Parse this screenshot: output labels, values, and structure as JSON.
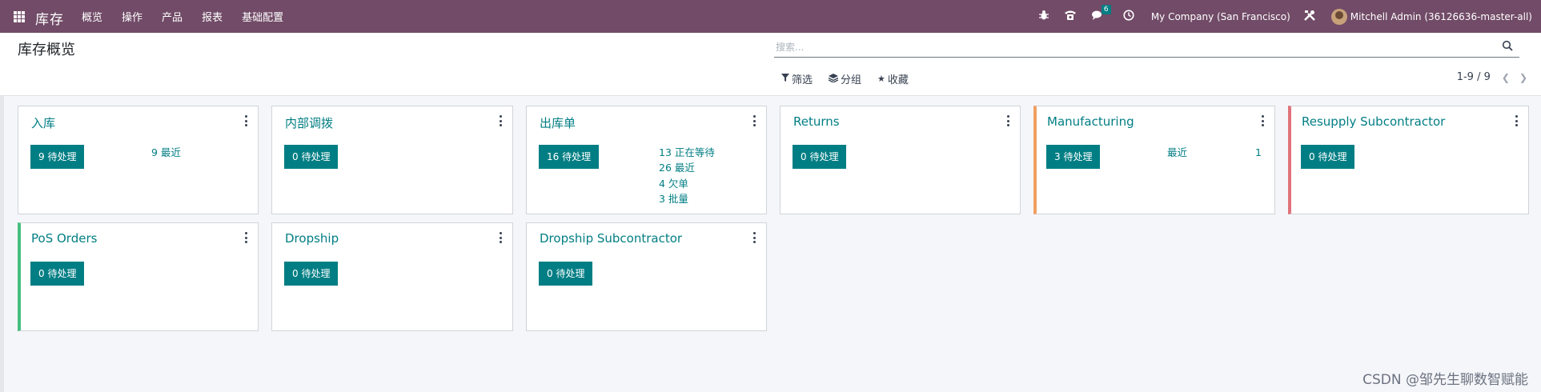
{
  "navbar": {
    "app_name": "库存",
    "menu": [
      "概览",
      "操作",
      "产品",
      "报表",
      "基础配置"
    ],
    "message_count": "6",
    "company": "My Company (San Francisco)",
    "user": "Mitchell Admin (36126636-master-all)",
    "icons": [
      "bug-icon",
      "phone-icon",
      "chat-icon",
      "clock-icon",
      "tools-icon"
    ]
  },
  "control_panel": {
    "title": "库存概览",
    "search_placeholder": "搜索...",
    "filters_label": "筛选",
    "groupby_label": "分组",
    "favorites_label": "收藏",
    "pager": "1-9 / 9"
  },
  "cards": [
    {
      "title": "入库",
      "todo": "9 待处理",
      "stats": [
        "9 最近"
      ]
    },
    {
      "title": "内部调拨",
      "todo": "0 待处理",
      "stats": []
    },
    {
      "title": "出库单",
      "todo": "16 待处理",
      "stats": [
        "13 正在等待",
        "26 最近",
        "4 欠单",
        "3 批量"
      ]
    },
    {
      "title": "Returns",
      "todo": "0 待处理",
      "stats": []
    },
    {
      "title": "Manufacturing",
      "todo": "3 待处理",
      "stats_label": "最近",
      "stats_value": "1",
      "accent": "#f0a062"
    },
    {
      "title": "Resupply Subcontractor",
      "todo": "0 待处理",
      "stats": [],
      "accent": "#e1737a"
    },
    {
      "title": "PoS Orders",
      "todo": "0 待处理",
      "stats": [],
      "accent": "#45bf80"
    },
    {
      "title": "Dropship",
      "todo": "0 待处理",
      "stats": []
    },
    {
      "title": "Dropship Subcontractor",
      "todo": "0 待处理",
      "stats": []
    }
  ],
  "watermark": "CSDN @邹先生聊数智赋能",
  "colors": {
    "navbar": "#714b67",
    "primary": "#017e84"
  }
}
